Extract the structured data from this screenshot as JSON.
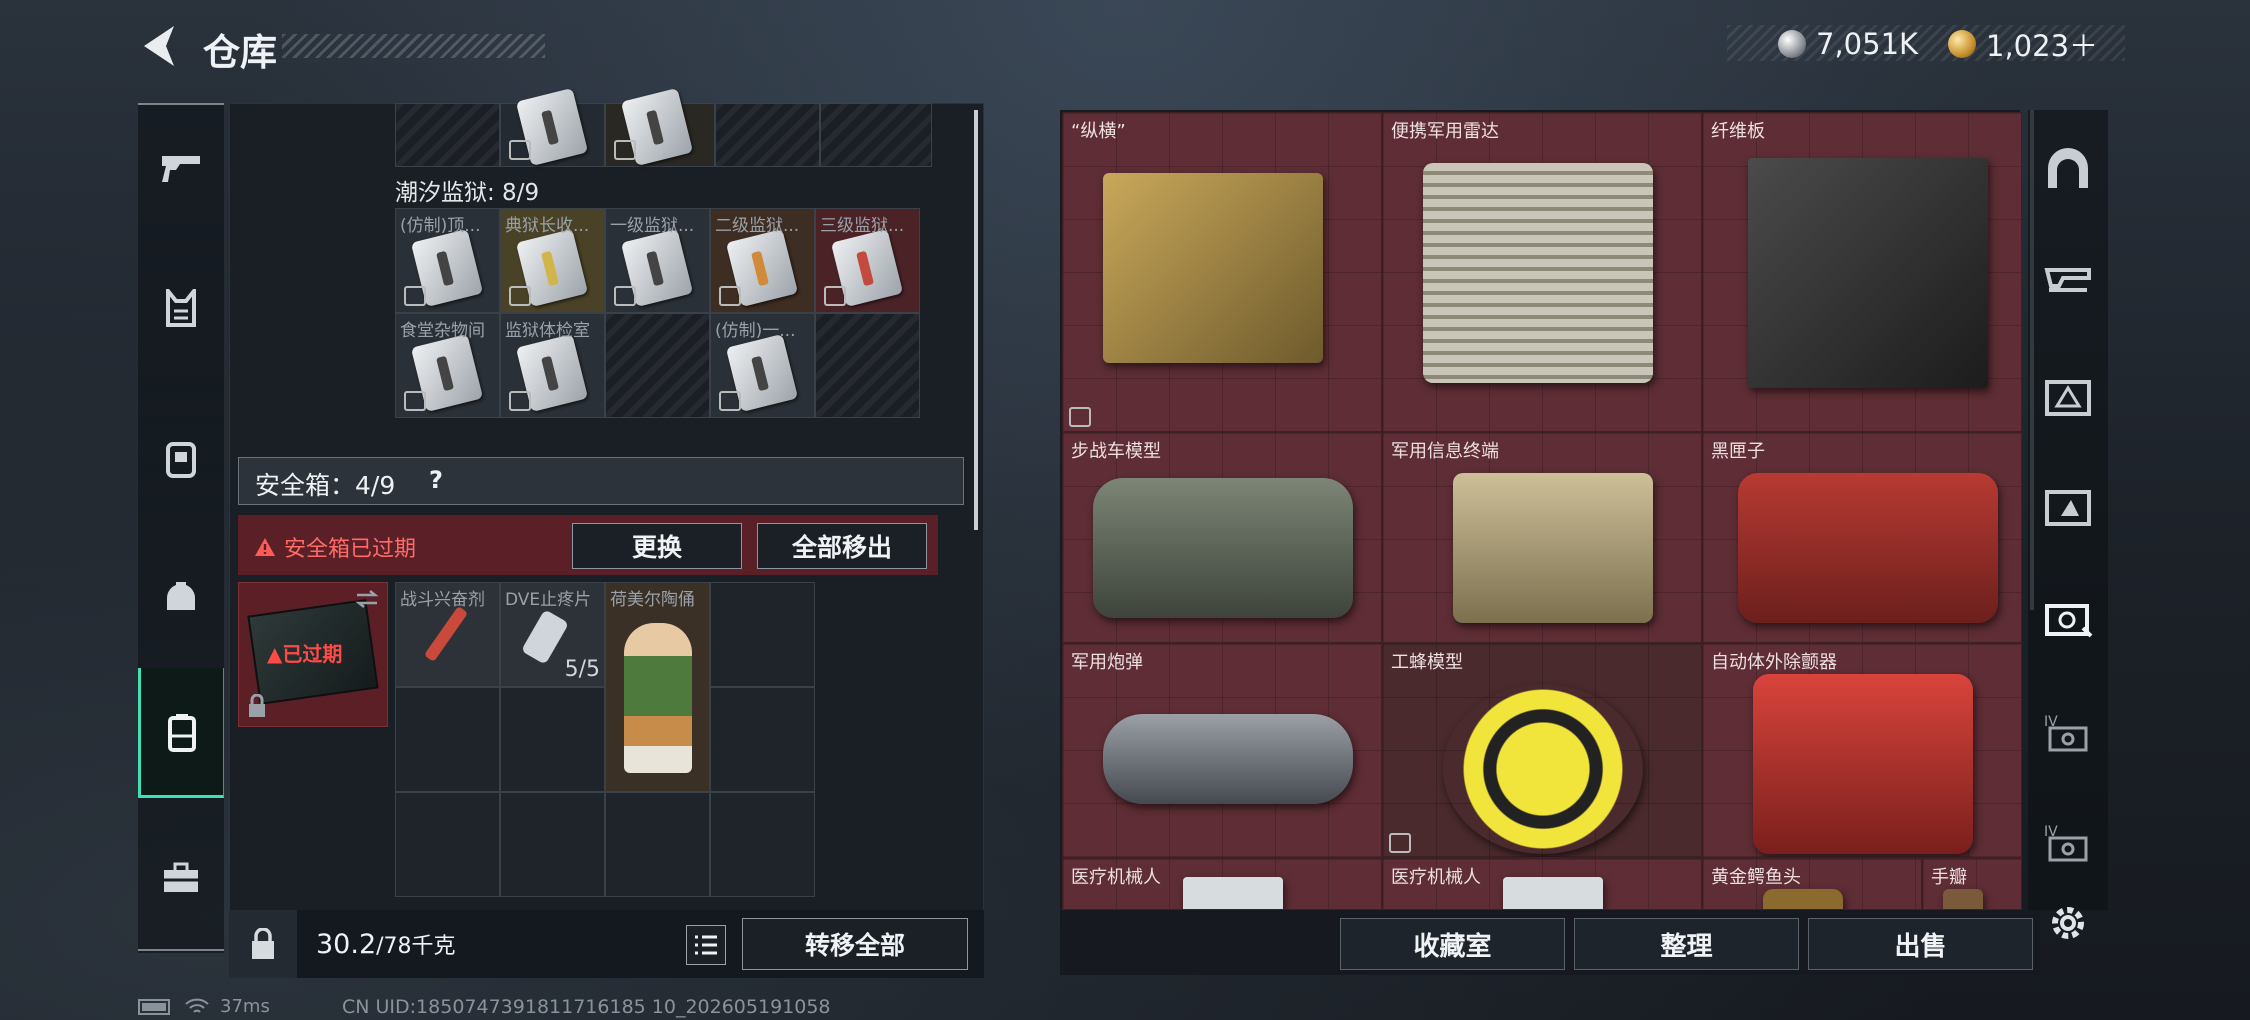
{
  "header": {
    "title": "仓库",
    "back_icon": "back-arrow-icon"
  },
  "currency": {
    "silver": "7,051K",
    "gold": "1,023＋"
  },
  "left_nav": {
    "items": [
      {
        "name": "weapons",
        "icon": "pistol-icon"
      },
      {
        "name": "armor",
        "icon": "vest-icon"
      },
      {
        "name": "backpack",
        "icon": "backpack-icon"
      },
      {
        "name": "helmet",
        "icon": "helmet-icon"
      },
      {
        "name": "storage",
        "icon": "container-icon",
        "active": true
      },
      {
        "name": "toolbox",
        "icon": "toolbox-icon"
      }
    ]
  },
  "tide_prison": {
    "label": "潮汐监狱: 8/9",
    "cells": [
      {
        "label": "(仿制)顶...",
        "tone": "gray"
      },
      {
        "label": "典狱长收...",
        "tone": "gold"
      },
      {
        "label": "一级监狱...",
        "tone": "gray"
      },
      {
        "label": "二级监狱...",
        "tone": "brown"
      },
      {
        "label": "三级监狱...",
        "tone": "red"
      },
      {
        "label": "食堂杂物间",
        "tone": "gray"
      },
      {
        "label": "监狱体检室",
        "tone": "gray"
      },
      {
        "label": "",
        "tone": "empty"
      },
      {
        "label": "(仿制)一...",
        "tone": "gray"
      },
      {
        "label": "",
        "tone": "empty"
      }
    ]
  },
  "safe_box": {
    "label": "安全箱：4/9",
    "help": "?",
    "alert": "安全箱已过期",
    "replace_btn": "更换",
    "move_all_btn": "全部移出",
    "expired_badge": "已过期"
  },
  "safe_items": [
    {
      "label": "战斗兴奋剂",
      "count": ""
    },
    {
      "label": "DVE止疼片",
      "count": "5/5"
    },
    {
      "label": "荷美尔陶俑",
      "count": ""
    }
  ],
  "footer": {
    "weight": "30.2",
    "weight_max": "/78千克",
    "transfer_all": "转移全部"
  },
  "right_items": [
    {
      "label": "“纵横”"
    },
    {
      "label": "便携军用雷达"
    },
    {
      "label": "纤维板"
    },
    {
      "label": "步战车模型"
    },
    {
      "label": "军用信息终端"
    },
    {
      "label": "黑匣子"
    },
    {
      "label": "军用炮弹"
    },
    {
      "label": "工蜂模型"
    },
    {
      "label": "自动体外除颤器"
    },
    {
      "label": "医疗机械人"
    },
    {
      "label": "医疗机械人"
    },
    {
      "label": "黄金鳄鱼头"
    },
    {
      "label": "手瓣"
    }
  ],
  "right_actions": {
    "collection": "收藏室",
    "organize": "整理",
    "sell": "出售"
  },
  "right_nav": {
    "tabs": [
      "IV",
      "IV"
    ]
  },
  "status": {
    "ping": "37ms",
    "uid": "CN UID:1850747391811716185 10_202605191058"
  }
}
